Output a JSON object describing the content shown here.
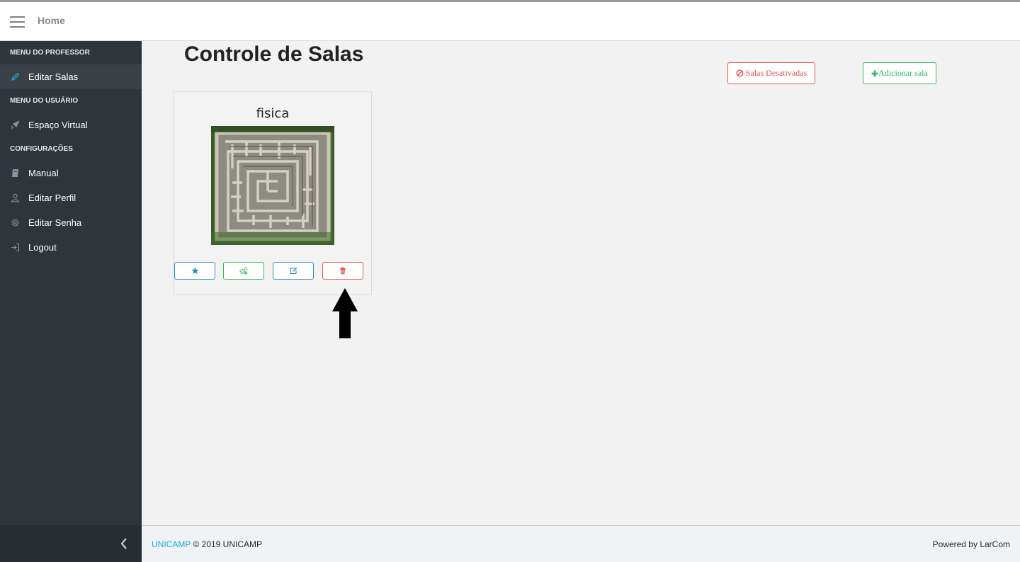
{
  "header": {
    "home_label": "Home"
  },
  "sidebar": {
    "sections": [
      {
        "title": "MENU DO PROFESSOR",
        "items": [
          {
            "label": "Editar Salas",
            "icon": "pencil-icon",
            "active": true
          }
        ]
      },
      {
        "title": "MENU DO USUÁRIO",
        "items": [
          {
            "label": "Espaço Virtual",
            "icon": "rocket-icon"
          }
        ]
      },
      {
        "title": "CONFIGURAÇÕES",
        "items": [
          {
            "label": "Manual",
            "icon": "book-icon"
          },
          {
            "label": "Editar Perfil",
            "icon": "user-icon"
          },
          {
            "label": "Editar Senha",
            "icon": "gear-icon"
          },
          {
            "label": "Logout",
            "icon": "logout-icon"
          }
        ]
      }
    ]
  },
  "main": {
    "title": "Controle de Salas",
    "disabled_rooms_label": "Salas Desativadas",
    "add_room_label": "Adicionar sala",
    "rooms": [
      {
        "name": "fisica",
        "image": "maze-image"
      }
    ]
  },
  "colors": {
    "danger": "#e55353",
    "success": "#2eb85c",
    "info": "#2e8ab8",
    "sidebar": "#2f353a",
    "link": "#20a8d8"
  },
  "footer": {
    "brand_link": "UNICAMP",
    "copyright": "© 2019 UNICAMP",
    "powered": "Powered by LarCom"
  }
}
